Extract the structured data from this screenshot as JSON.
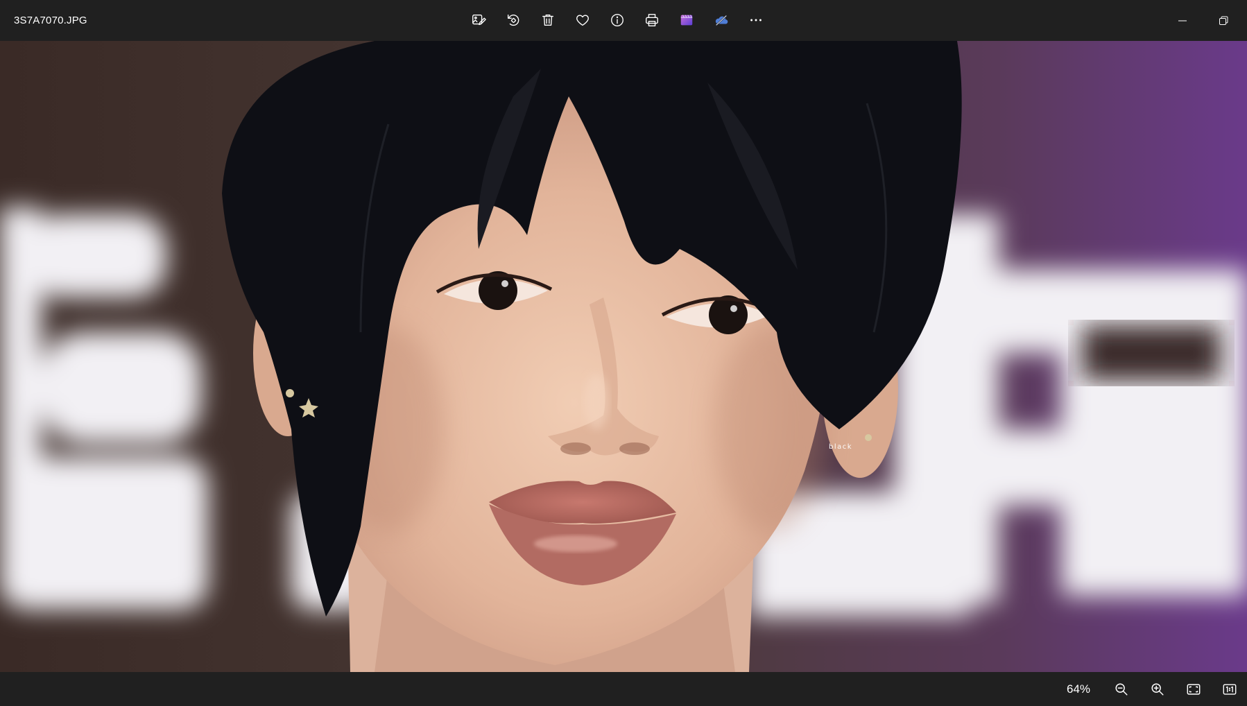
{
  "window": {
    "file_name": "3S7A7070.JPG"
  },
  "toolbar": {
    "items": [
      {
        "name": "edit-image",
        "icon": "edit-image-icon"
      },
      {
        "name": "rotate",
        "icon": "rotate-icon"
      },
      {
        "name": "delete",
        "icon": "trash-icon"
      },
      {
        "name": "favorite",
        "icon": "heart-icon"
      },
      {
        "name": "file-info",
        "icon": "info-icon"
      },
      {
        "name": "print",
        "icon": "printer-icon"
      },
      {
        "name": "clipchamp",
        "icon": "clipchamp-icon"
      },
      {
        "name": "onedrive",
        "icon": "onedrive-icon"
      },
      {
        "name": "more",
        "icon": "more-icon"
      }
    ]
  },
  "photo": {
    "watermark": "black"
  },
  "status": {
    "zoom_level": "64%"
  },
  "colors": {
    "chrome_bg": "#202020",
    "icon": "#ffffff",
    "accent_purple": "#7b52e8",
    "onedrive_blue": "#4f7dd6"
  }
}
